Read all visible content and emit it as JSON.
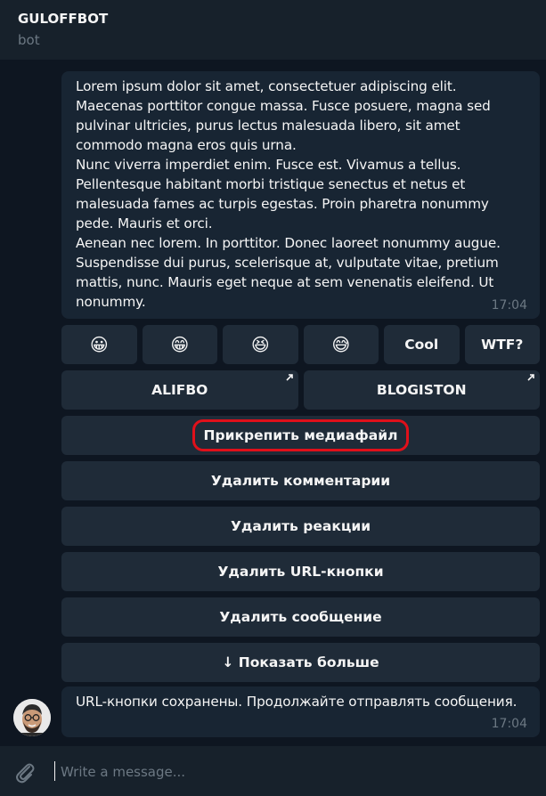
{
  "header": {
    "title": "GULOFFBOT",
    "subtitle": "bot"
  },
  "messages": [
    {
      "text": "Lorem ipsum dolor sit amet, consectetuer adipiscing elit.\nMaecenas porttitor congue massa. Fusce posuere, magna sed pulvinar ultricies, purus lectus malesuada libero, sit amet commodo magna eros quis urna.\nNunc viverra imperdiet enim. Fusce est. Vivamus a tellus.\nPellentesque habitant morbi tristique senectus et netus et malesuada fames ac turpis egestas. Proin pharetra nonummy pede. Mauris et orci.\nAenean nec lorem. In porttitor. Donec laoreet nonummy augue.\nSuspendisse dui purus, scelerisque at, vulputate vitae, pretium mattis, nunc. Mauris eget neque at sem venenatis eleifend. Ut nonummy.",
      "time": "17:04"
    },
    {
      "text": "URL-кнопки сохранены. Продолжайте отправлять сообщения.",
      "time": "17:04"
    }
  ],
  "keyboard": {
    "reactions": [
      {
        "label": "😀",
        "icon": "grinning-face"
      },
      {
        "label": "😁",
        "icon": "beaming-face"
      },
      {
        "label": "😆",
        "icon": "squinting-face"
      },
      {
        "label": "😅",
        "icon": "sweat-smile-face"
      },
      {
        "label": "Cool"
      },
      {
        "label": "WTF?"
      }
    ],
    "links": [
      {
        "label": "ALIFBO",
        "icon": "external-link-arrow"
      },
      {
        "label": "BLOGISTON",
        "icon": "external-link-arrow"
      }
    ],
    "actions": [
      {
        "label": "Прикрепить медиафайл",
        "highlighted": true
      },
      {
        "label": "Удалить комментарии"
      },
      {
        "label": "Удалить реакции"
      },
      {
        "label": "Удалить URL-кнопки"
      },
      {
        "label": "Удалить сообщение"
      },
      {
        "label": "↓ Показать больше"
      }
    ]
  },
  "composer": {
    "placeholder": "Write a message...",
    "attach_icon": "paperclip-icon"
  },
  "colors": {
    "background": "#0e1621",
    "panel": "#17212b",
    "bubble": "#182533",
    "button": "#1f2b38",
    "muted": "#6c7883",
    "highlight": "#e0101a"
  }
}
